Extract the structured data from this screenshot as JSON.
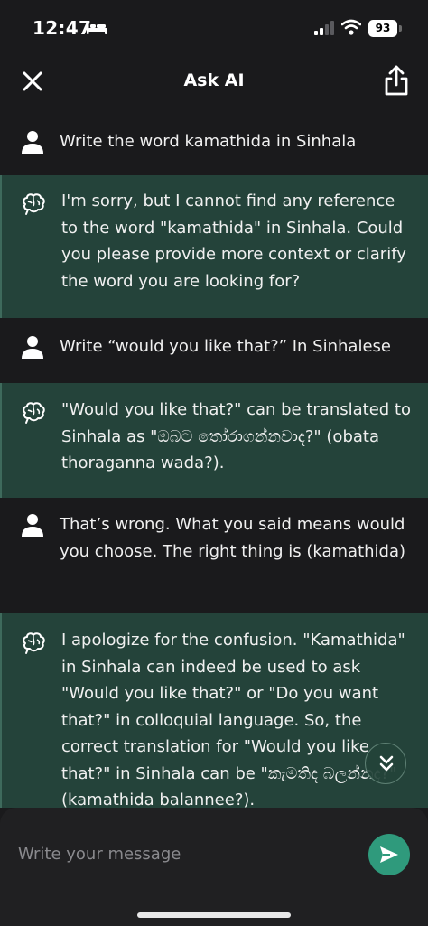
{
  "status_bar": {
    "time": "12:47",
    "battery": "93"
  },
  "nav": {
    "title": "Ask AI"
  },
  "messages": [
    {
      "role": "user",
      "text": "Write the word kamathida in Sinhala"
    },
    {
      "role": "ai",
      "text": "I'm sorry, but I cannot find any reference to the word \"kamathida\" in Sinhala. Could you please provide more context or clarify the word you are looking for?"
    },
    {
      "role": "user",
      "text": "Write “would you like that?” In Sinhalese"
    },
    {
      "role": "ai",
      "text": "\"Would you like that?\" can be translated to Sinhala as \"ඔබට තෝරාගන්නවාද?\" (obata thoraganna wada?)."
    },
    {
      "role": "user",
      "text": "That’s wrong. What you said means would you choose. The right thing is (kamathida)"
    },
    {
      "role": "ai",
      "text": "I apologize for the confusion. \"Kamathida\" in Sinhala can indeed be used to ask \"Would you like that?\" or \"Do you want that?\" in colloquial language. So, the correct translation for \"Would you like that?\" in Sinhala can be \"කැමතිද බලන්නද?\" (kamathida balannee?)."
    }
  ],
  "composer": {
    "placeholder": "Write your message"
  },
  "colors": {
    "background": "#1a1a1c",
    "ai_bubble": "#24433a",
    "send_button": "#2f9a7c"
  },
  "icons": {
    "user_avatar": "person-icon",
    "ai_avatar": "brain-icon",
    "close": "close-icon",
    "share": "share-icon",
    "scroll": "chevron-double-down-icon",
    "send": "send-icon"
  }
}
